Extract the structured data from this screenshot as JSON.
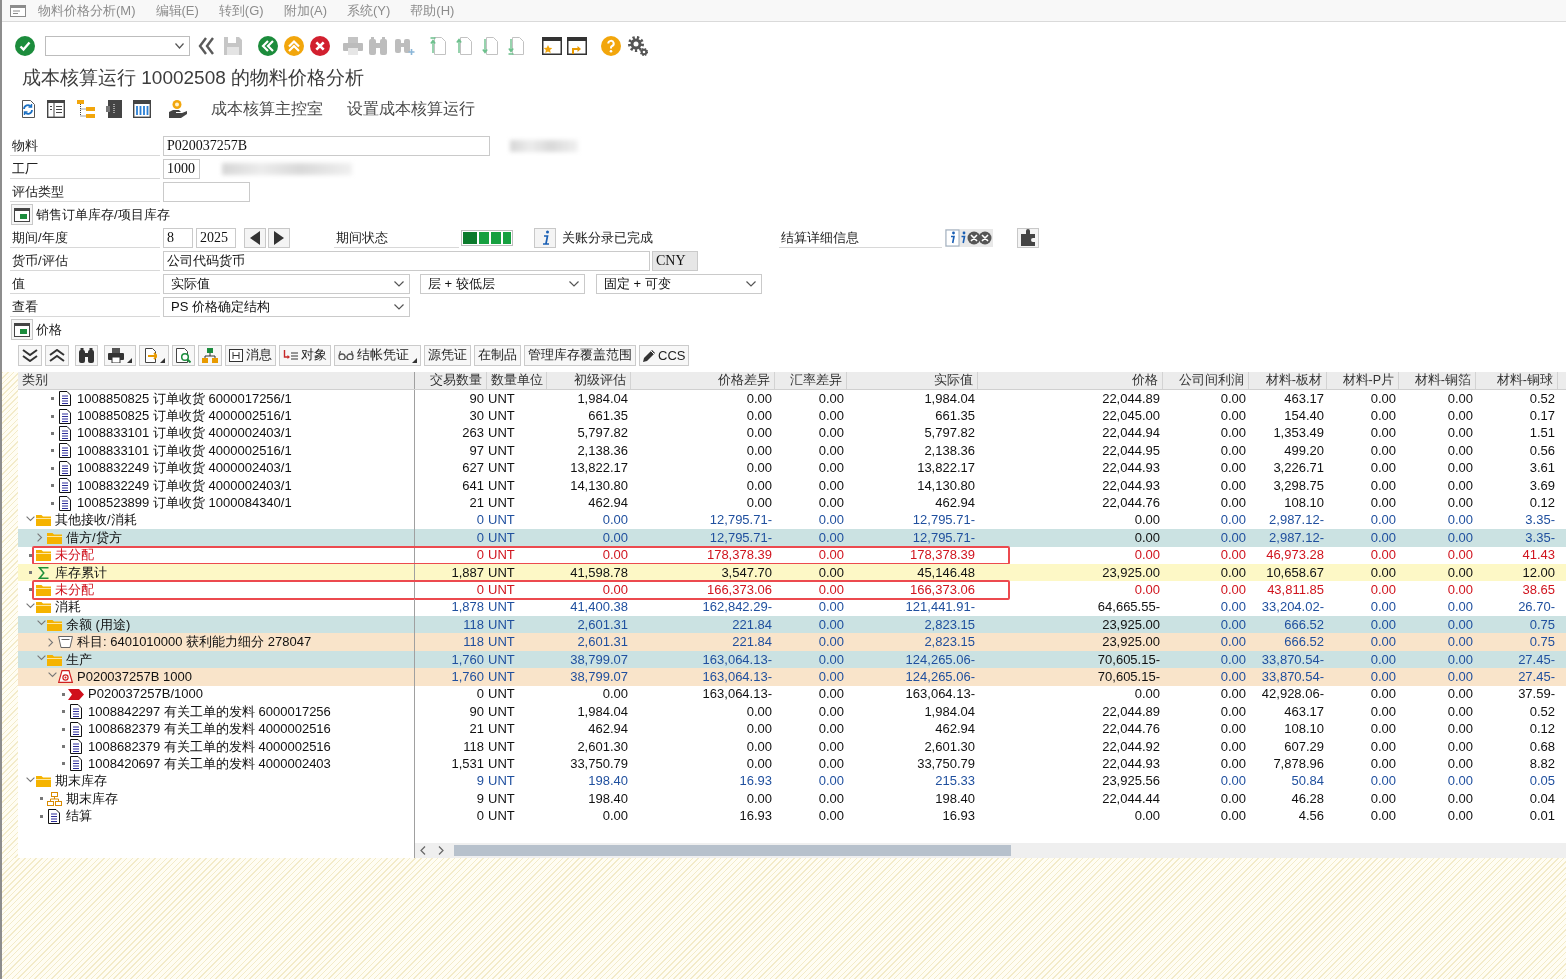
{
  "menu_bar": {
    "items": [
      "物料价格分析(M)",
      "编辑(E)",
      "转到(G)",
      "附加(A)",
      "系统(Y)",
      "帮助(H)"
    ]
  },
  "title": "成本核算运行 10002508 的物料价格分析",
  "app_toolbar": {
    "buttons": [
      "成本核算主控室",
      "设置成本核算运行"
    ]
  },
  "form": {
    "material": {
      "label": "物料",
      "value": "P020037257B"
    },
    "plant": {
      "label": "工厂",
      "value": "1000"
    },
    "valuation_type": {
      "label": "评估类型"
    },
    "stock_section": {
      "label": "销售订单库存/项目库存"
    },
    "period": {
      "label": "期间/年度",
      "period": "8",
      "year": "2025"
    },
    "period_status": {
      "label": "期间状态",
      "text": "关账分录已完成"
    },
    "settlement": {
      "label": "结算详细信息"
    },
    "currency": {
      "label": "货币/评估",
      "value": "公司代码货币",
      "unit": "CNY"
    },
    "value_type": {
      "label": "值",
      "selects": [
        "实际值",
        "层 + 较低层",
        "固定 + 可变"
      ]
    },
    "view": {
      "label": "查看",
      "value": "PS 价格确定结构"
    },
    "price_section": {
      "label": "价格"
    }
  },
  "alv_toolbar": {
    "buttons": [
      {
        "label": "消息",
        "kind": "message",
        "dropdown": false
      },
      {
        "label": "对象",
        "kind": "object",
        "dropdown": false
      },
      {
        "label": "结帐凭证",
        "kind": "document",
        "dropdown": true
      },
      {
        "label": "源凭证",
        "kind": "plain",
        "dropdown": false
      },
      {
        "label": "在制品",
        "kind": "plain",
        "dropdown": false
      },
      {
        "label": "管理库存覆盖范围",
        "kind": "plain",
        "dropdown": false
      },
      {
        "label": "CCS",
        "kind": "edit",
        "dropdown": false
      }
    ]
  },
  "table": {
    "columns": [
      "类别",
      "交易数量",
      "数量单位",
      "初级评估",
      "价格差异",
      "汇率差异",
      "实际值",
      "价格",
      "公司间利润",
      "材料-板材",
      "材料-P片",
      "材料-铜箔",
      "材料-铜球"
    ],
    "rows": [
      {
        "children": [
          {
            "children": [
              {
                "label": "1008850825 订单收货 6000017256/1",
                "kind": "document",
                "subtotal": false,
                "alert": false,
                "annotated": false,
                "cells": [
                  "90",
                  "UNT",
                  "1,984.04",
                  "0.00",
                  "0.00",
                  "1,984.04",
                  "22,044.89",
                  "0.00",
                  "463.17",
                  "0.00",
                  "0.00",
                  "0.52"
                ]
              },
              {
                "label": "1008850825 订单收货 4000002516/1",
                "kind": "document",
                "subtotal": false,
                "alert": false,
                "annotated": false,
                "cells": [
                  "30",
                  "UNT",
                  "661.35",
                  "0.00",
                  "0.00",
                  "661.35",
                  "22,045.00",
                  "0.00",
                  "154.40",
                  "0.00",
                  "0.00",
                  "0.17"
                ]
              },
              {
                "label": "1008833101 订单收货 4000002403/1",
                "kind": "document",
                "subtotal": false,
                "alert": false,
                "annotated": false,
                "cells": [
                  "263",
                  "UNT",
                  "5,797.82",
                  "0.00",
                  "0.00",
                  "5,797.82",
                  "22,044.94",
                  "0.00",
                  "1,353.49",
                  "0.00",
                  "0.00",
                  "1.51"
                ]
              },
              {
                "label": "1008833101 订单收货 4000002516/1",
                "kind": "document",
                "subtotal": false,
                "alert": false,
                "annotated": false,
                "cells": [
                  "97",
                  "UNT",
                  "2,138.36",
                  "0.00",
                  "0.00",
                  "2,138.36",
                  "22,044.95",
                  "0.00",
                  "499.20",
                  "0.00",
                  "0.00",
                  "0.56"
                ]
              },
              {
                "label": "1008832249 订单收货 4000002403/1",
                "kind": "document",
                "subtotal": false,
                "alert": false,
                "annotated": false,
                "cells": [
                  "627",
                  "UNT",
                  "13,822.17",
                  "0.00",
                  "0.00",
                  "13,822.17",
                  "22,044.93",
                  "0.00",
                  "3,226.71",
                  "0.00",
                  "0.00",
                  "3.61"
                ]
              },
              {
                "label": "1008832249 订单收货 4000002403/1",
                "kind": "document",
                "subtotal": false,
                "alert": false,
                "annotated": false,
                "cells": [
                  "641",
                  "UNT",
                  "14,130.80",
                  "0.00",
                  "0.00",
                  "14,130.80",
                  "22,044.93",
                  "0.00",
                  "3,298.75",
                  "0.00",
                  "0.00",
                  "3.69"
                ]
              },
              {
                "label": "1008523899 订单收货 1000084340/1",
                "kind": "document",
                "subtotal": false,
                "alert": false,
                "annotated": false,
                "cells": [
                  "21",
                  "UNT",
                  "462.94",
                  "0.00",
                  "0.00",
                  "462.94",
                  "22,044.76",
                  "0.00",
                  "108.10",
                  "0.00",
                  "0.00",
                  "0.12"
                ]
              }
            ]
          }
        ]
      },
      {
        "label": "其他接收/消耗",
        "kind": "folder",
        "subtotal": true,
        "alert": false,
        "expanded": true,
        "annotated": false,
        "cells": [
          "0",
          "UNT",
          "0.00",
          "12,795.71-",
          "0.00",
          "12,795.71-",
          "0.00",
          "0.00",
          "2,987.12-",
          "0.00",
          "0.00",
          "3.35-"
        ],
        "children": [
          {
            "label": "借方/贷方",
            "kind": "folder",
            "subtotal": true,
            "alert": false,
            "expanded": false,
            "annotated": false,
            "color": "#cbe2e2",
            "cells": [
              "0",
              "UNT",
              "0.00",
              "12,795.71-",
              "0.00",
              "12,795.71-",
              "0.00",
              "0.00",
              "2,987.12-",
              "0.00",
              "0.00",
              "3.35-"
            ]
          }
        ]
      },
      {
        "label": "未分配",
        "kind": "folder",
        "subtotal": false,
        "alert": true,
        "annotated": true,
        "cells": [
          "0",
          "UNT",
          "0.00",
          "178,378.39",
          "0.00",
          "178,378.39",
          "0.00",
          "0.00",
          "46,973.28",
          "0.00",
          "0.00",
          "41.43"
        ]
      },
      {
        "label": "库存累计",
        "kind": "total",
        "subtotal": false,
        "alert": false,
        "annotated": false,
        "color": "#fdf8c6",
        "cells": [
          "1,887",
          "UNT",
          "41,598.78",
          "3,547.70",
          "0.00",
          "45,146.48",
          "23,925.00",
          "0.00",
          "10,658.67",
          "0.00",
          "0.00",
          "12.00"
        ]
      },
      {
        "label": "未分配",
        "kind": "folder",
        "subtotal": false,
        "alert": true,
        "annotated": true,
        "cells": [
          "0",
          "UNT",
          "0.00",
          "166,373.06",
          "0.00",
          "166,373.06",
          "0.00",
          "0.00",
          "43,811.85",
          "0.00",
          "0.00",
          "38.65"
        ]
      },
      {
        "label": "消耗",
        "kind": "folder",
        "subtotal": true,
        "alert": false,
        "expanded": true,
        "annotated": false,
        "cells": [
          "1,878",
          "UNT",
          "41,400.38",
          "162,842.29-",
          "0.00",
          "121,441.91-",
          "64,665.55-",
          "0.00",
          "33,204.02-",
          "0.00",
          "0.00",
          "26.70-"
        ],
        "children": [
          {
            "label": "余额 (用途)",
            "kind": "folder",
            "subtotal": true,
            "alert": false,
            "expanded": true,
            "annotated": false,
            "color": "#cbe2e2",
            "cells": [
              "118",
              "UNT",
              "2,601.31",
              "221.84",
              "0.00",
              "2,823.15",
              "23,925.00",
              "0.00",
              "666.52",
              "0.00",
              "0.00",
              "0.75"
            ],
            "children": [
              {
                "label": "科目: 6401010000 获利能力细分 278047",
                "kind": "account",
                "subtotal": true,
                "alert": false,
                "expanded": false,
                "annotated": false,
                "color": "#f9e4ca",
                "cells": [
                  "118",
                  "UNT",
                  "2,601.31",
                  "221.84",
                  "0.00",
                  "2,823.15",
                  "23,925.00",
                  "0.00",
                  "666.52",
                  "0.00",
                  "0.00",
                  "0.75"
                ]
              }
            ]
          },
          {
            "label": "生产",
            "kind": "folder",
            "subtotal": true,
            "alert": false,
            "expanded": true,
            "annotated": false,
            "color": "#cbe2e2",
            "cells": [
              "1,760",
              "UNT",
              "38,799.07",
              "163,064.13-",
              "0.00",
              "124,265.06-",
              "70,605.15-",
              "0.00",
              "33,870.54-",
              "0.00",
              "0.00",
              "27.45-"
            ],
            "children": [
              {
                "label": "P020037257B 1000",
                "kind": "order",
                "subtotal": true,
                "alert": false,
                "expanded": true,
                "annotated": false,
                "color": "#f9e4ca",
                "cells": [
                  "1,760",
                  "UNT",
                  "38,799.07",
                  "163,064.13-",
                  "0.00",
                  "124,265.06-",
                  "70,605.15-",
                  "0.00",
                  "33,870.54-",
                  "0.00",
                  "0.00",
                  "27.45-"
                ],
                "children": [
                  {
                    "label": "P020037257B/1000",
                    "kind": "material",
                    "subtotal": false,
                    "alert": false,
                    "annotated": false,
                    "cells": [
                      "0",
                      "UNT",
                      "0.00",
                      "163,064.13-",
                      "0.00",
                      "163,064.13-",
                      "0.00",
                      "0.00",
                      "42,928.06-",
                      "0.00",
                      "0.00",
                      "37.59-"
                    ]
                  },
                  {
                    "label": "1008842297 有关工单的发料 6000017256",
                    "kind": "document",
                    "subtotal": false,
                    "alert": false,
                    "annotated": false,
                    "cells": [
                      "90",
                      "UNT",
                      "1,984.04",
                      "0.00",
                      "0.00",
                      "1,984.04",
                      "22,044.89",
                      "0.00",
                      "463.17",
                      "0.00",
                      "0.00",
                      "0.52"
                    ]
                  },
                  {
                    "label": "1008682379 有关工单的发料 4000002516",
                    "kind": "document",
                    "subtotal": false,
                    "alert": false,
                    "annotated": false,
                    "cells": [
                      "21",
                      "UNT",
                      "462.94",
                      "0.00",
                      "0.00",
                      "462.94",
                      "22,044.76",
                      "0.00",
                      "108.10",
                      "0.00",
                      "0.00",
                      "0.12"
                    ]
                  },
                  {
                    "label": "1008682379 有关工单的发料 4000002516",
                    "kind": "document",
                    "subtotal": false,
                    "alert": false,
                    "annotated": false,
                    "cells": [
                      "118",
                      "UNT",
                      "2,601.30",
                      "0.00",
                      "0.00",
                      "2,601.30",
                      "22,044.92",
                      "0.00",
                      "607.29",
                      "0.00",
                      "0.00",
                      "0.68"
                    ]
                  },
                  {
                    "label": "1008420697 有关工单的发料 4000002403",
                    "kind": "document",
                    "subtotal": false,
                    "alert": false,
                    "annotated": false,
                    "cells": [
                      "1,531",
                      "UNT",
                      "33,750.79",
                      "0.00",
                      "0.00",
                      "33,750.79",
                      "22,044.93",
                      "0.00",
                      "7,878.96",
                      "0.00",
                      "0.00",
                      "8.82"
                    ]
                  }
                ]
              }
            ]
          }
        ]
      },
      {
        "label": "期末库存",
        "kind": "folder",
        "subtotal": true,
        "alert": false,
        "expanded": true,
        "annotated": false,
        "cells": [
          "9",
          "UNT",
          "198.40",
          "16.93",
          "0.00",
          "215.33",
          "23,925.56",
          "0.00",
          "50.84",
          "0.00",
          "0.00",
          "0.05"
        ],
        "children": [
          {
            "label": "期末库存",
            "kind": "stock",
            "subtotal": false,
            "alert": false,
            "annotated": false,
            "cells": [
              "9",
              "UNT",
              "198.40",
              "0.00",
              "0.00",
              "198.40",
              "22,044.44",
              "0.00",
              "46.28",
              "0.00",
              "0.00",
              "0.04"
            ]
          },
          {
            "label": "结算",
            "kind": "document",
            "subtotal": false,
            "alert": false,
            "annotated": false,
            "cells": [
              "0",
              "UNT",
              "0.00",
              "16.93",
              "0.00",
              "16.93",
              "0.00",
              "0.00",
              "4.56",
              "0.00",
              "0.00",
              "0.01"
            ]
          }
        ]
      }
    ]
  }
}
